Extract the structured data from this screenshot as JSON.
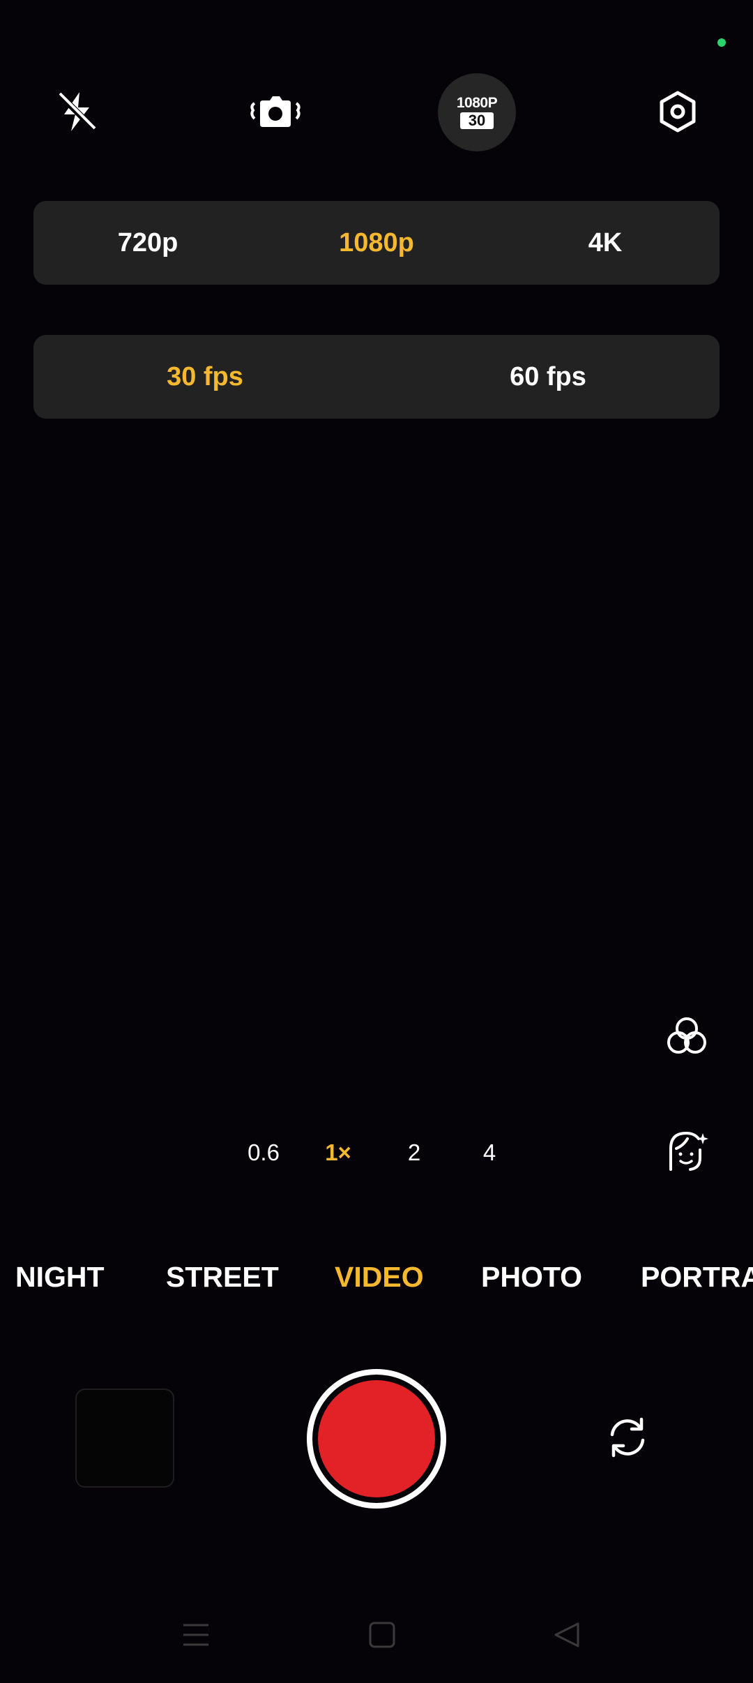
{
  "status": {
    "privacy_indicator_color": "#2bd46a"
  },
  "top_bar": {
    "flash_icon": "flash-off-icon",
    "stabilization_icon": "stabilization-icon",
    "resolution_badge": {
      "resolution": "1080P",
      "frame_rate": "30"
    },
    "settings_icon": "gear-icon"
  },
  "resolution_options": {
    "options": [
      "720p",
      "1080p",
      "4K"
    ],
    "selected": "1080p"
  },
  "fps_options": {
    "options": [
      "30 fps",
      "60 fps"
    ],
    "selected": "30 fps"
  },
  "side_controls": {
    "filter_icon": "filter-circles-icon",
    "beauty_icon": "beauty-face-icon"
  },
  "zoom": {
    "levels": [
      "0.6",
      "1×",
      "2",
      "4"
    ],
    "selected": "1×"
  },
  "modes": {
    "items": [
      "NIGHT",
      "STREET",
      "VIDEO",
      "PHOTO",
      "PORTRA"
    ],
    "selected": "VIDEO"
  },
  "bottom_controls": {
    "gallery_thumbnail": "gallery-thumbnail",
    "record_button_color": "#e32227",
    "flip_icon": "switch-camera-icon"
  },
  "navigation": {
    "menu_icon": "recents-menu-icon",
    "home_icon": "home-square-icon",
    "back_icon": "back-triangle-icon"
  },
  "colors": {
    "accent": "#f5b82e",
    "background": "#050307",
    "panel": "#222223",
    "record": "#e32227"
  }
}
